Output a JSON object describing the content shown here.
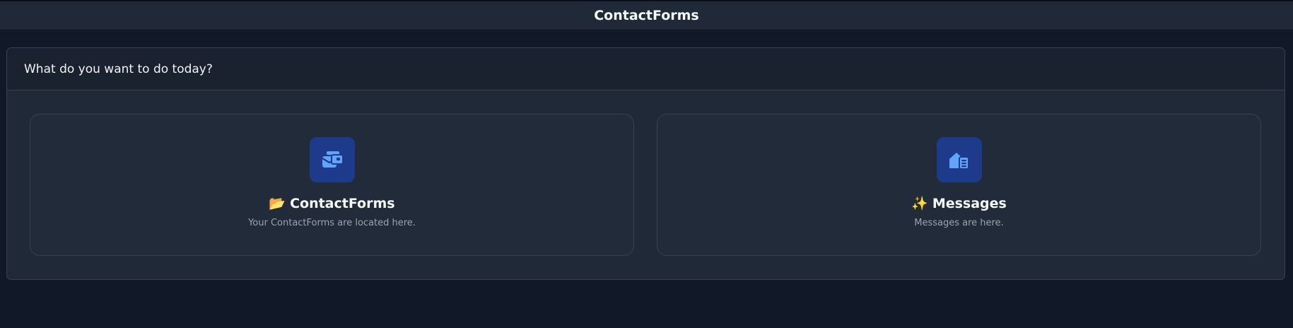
{
  "header": {
    "title": "ContactForms"
  },
  "panel": {
    "title": "What do you want to do today?"
  },
  "cards": [
    {
      "emoji": "📂",
      "title": "ContactForms",
      "description": "Your ContactForms are located here.",
      "icon": "forms-stack-icon"
    },
    {
      "emoji": "✨",
      "title": "Messages",
      "description": "Messages are here.",
      "icon": "mail-open-icon"
    }
  ],
  "colors": {
    "background": "#111827",
    "surface": "#1f2937",
    "card": "#222b39",
    "border": "#374151",
    "icon_bg": "#1e3a8a",
    "icon_fg": "#60a5fa",
    "muted_text": "#9ca3af"
  }
}
